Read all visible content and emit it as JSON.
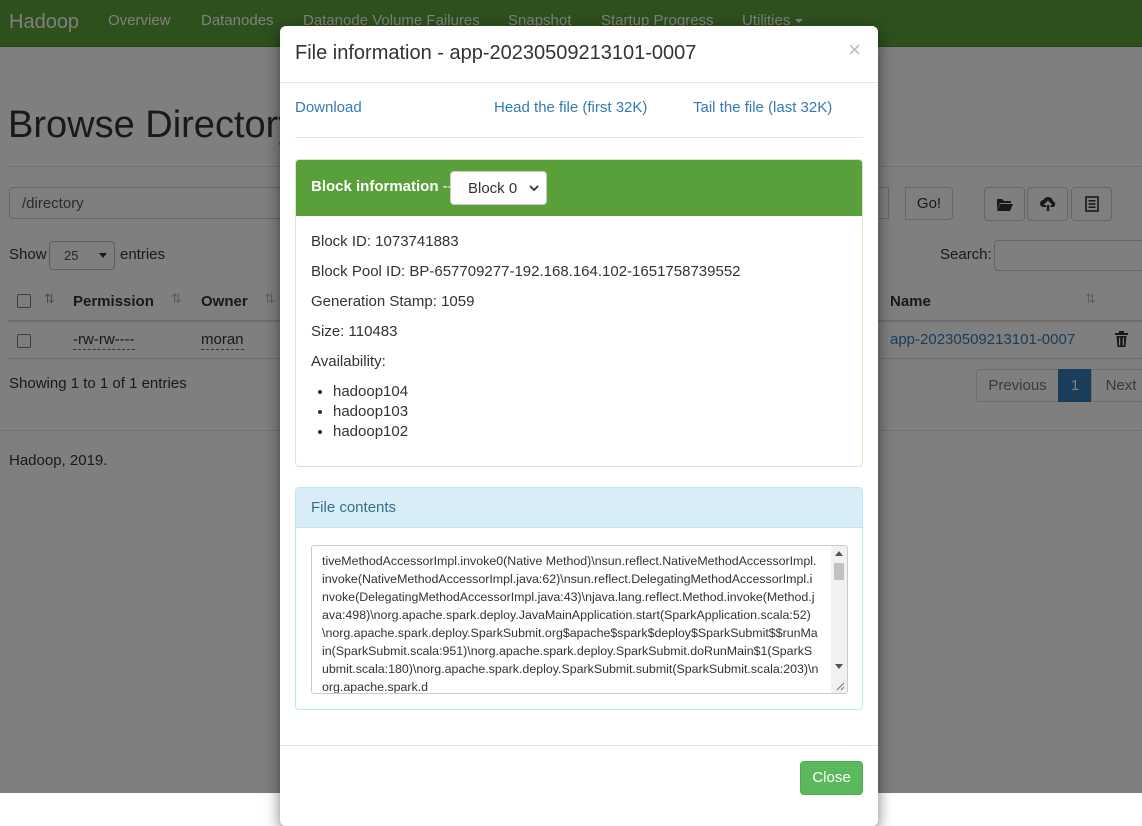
{
  "navbar": {
    "brand": "Hadoop",
    "items": [
      "Overview",
      "Datanodes",
      "Datanode Volume Failures",
      "Snapshot",
      "Startup Progress",
      "Utilities"
    ]
  },
  "page": {
    "title": "Browse Directory",
    "directory_value": "/directory",
    "go_label": "Go!",
    "show_label": "Show",
    "entries_value": "25",
    "entries_label": "entries",
    "search_label": "Search:",
    "table": {
      "headers": [
        "Permission",
        "Owner",
        "Name"
      ],
      "rows": [
        {
          "permission": "-rw-rw----",
          "owner": "moran",
          "name": "app-20230509213101-0007"
        }
      ]
    },
    "showing_text": "Showing 1 to 1 of 1 entries",
    "pagination": {
      "previous": "Previous",
      "current": "1",
      "next": "Next"
    },
    "footer": "Hadoop, 2019."
  },
  "modal": {
    "title": "File information - app-20230509213101-0007",
    "close_x": "×",
    "links": {
      "download": "Download",
      "head": "Head the file (first 32K)",
      "tail": "Tail the file (last 32K)"
    },
    "block_panel": {
      "heading": "Block information",
      "heading_separator": "--",
      "selected_block": "Block 0",
      "block_id": "Block ID: 1073741883",
      "block_pool_id": "Block Pool ID: BP-657709277-192.168.164.102-1651758739552",
      "generation_stamp": "Generation Stamp: 1059",
      "size": "Size: 110483",
      "availability_label": "Availability:",
      "availability": [
        "hadoop104",
        "hadoop103",
        "hadoop102"
      ]
    },
    "contents_panel": {
      "heading": "File contents",
      "text": "tiveMethodAccessorImpl.invoke0(Native Method)\\nsun.reflect.NativeMethodAccessorImpl.invoke(NativeMethodAccessorImpl.java:62)\\nsun.reflect.DelegatingMethodAccessorImpl.invoke(DelegatingMethodAccessorImpl.java:43)\\njava.lang.reflect.Method.invoke(Method.java:498)\\norg.apache.spark.deploy.JavaMainApplication.start(SparkApplication.scala:52)\\norg.apache.spark.deploy.SparkSubmit.org$apache$spark$deploy$SparkSubmit$$runMain(SparkSubmit.scala:951)\\norg.apache.spark.deploy.SparkSubmit.doRunMain$1(SparkSubmit.scala:180)\\norg.apache.spark.deploy.SparkSubmit.submit(SparkSubmit.scala:203)\\norg.apache.spark.d"
    },
    "close_button": "Close"
  },
  "colors": {
    "brand_green": "#5aa03a",
    "link_blue": "#337ab7",
    "info_panel_bg": "#d9edf7",
    "close_button_green": "#5cb85c"
  },
  "icons": [
    "folder-open-icon",
    "cloud-upload-icon",
    "list-icon",
    "sort-icon",
    "trash-icon",
    "chevron-down-icon",
    "close-icon"
  ]
}
